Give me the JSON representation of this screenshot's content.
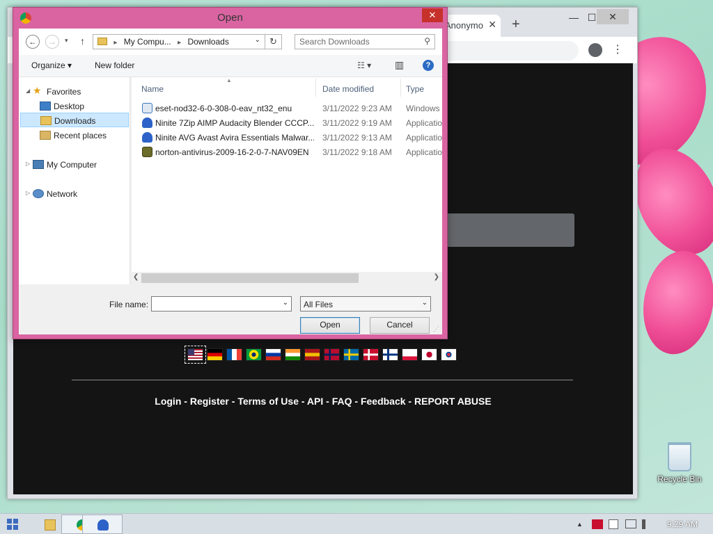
{
  "desktop": {
    "recycle_bin_label": "Recycle Bin"
  },
  "browser": {
    "tab_title": "Anonymo",
    "tab_close": "✕",
    "new_tab": "+",
    "minimize": "—",
    "maximize": "☐",
    "close": "✕",
    "menu": "⋮",
    "languages": [
      {
        "code": "en",
        "colors": [
          "#b22234",
          "#ffffff",
          "#3c3b6e"
        ],
        "selected": true
      },
      {
        "code": "de",
        "colors": [
          "#000000",
          "#dd0000",
          "#ffce00"
        ]
      },
      {
        "code": "fr",
        "colors": [
          "#0055a4",
          "#ffffff",
          "#ef4135"
        ]
      },
      {
        "code": "br",
        "colors": [
          "#009c3b",
          "#ffdf00",
          "#002776"
        ]
      },
      {
        "code": "ru",
        "colors": [
          "#ffffff",
          "#0039a6",
          "#d52b1e"
        ]
      },
      {
        "code": "in",
        "colors": [
          "#ff9933",
          "#ffffff",
          "#138808"
        ]
      },
      {
        "code": "es",
        "colors": [
          "#aa151b",
          "#f1bf00",
          "#aa151b"
        ]
      },
      {
        "code": "no",
        "colors": [
          "#ba0c2f",
          "#ffffff",
          "#00205b"
        ]
      },
      {
        "code": "se",
        "colors": [
          "#006aa7",
          "#fecc00",
          "#006aa7"
        ]
      },
      {
        "code": "dk",
        "colors": [
          "#c8102e",
          "#ffffff",
          "#c8102e"
        ]
      },
      {
        "code": "fi",
        "colors": [
          "#ffffff",
          "#003580",
          "#ffffff"
        ]
      },
      {
        "code": "pl",
        "colors": [
          "#ffffff",
          "#ffffff",
          "#dc143c"
        ]
      },
      {
        "code": "jp",
        "colors": [
          "#ffffff",
          "#bc002d",
          "#ffffff"
        ]
      },
      {
        "code": "kr",
        "colors": [
          "#ffffff",
          "#cd2e3a",
          "#0047a0"
        ]
      }
    ],
    "footer_links": [
      "Login",
      "Register",
      "Terms of Use",
      "API",
      "FAQ",
      "Feedback",
      "REPORT ABUSE"
    ],
    "footer_sep": " - "
  },
  "dialog": {
    "title": "Open",
    "close": "✕",
    "back": "←",
    "forward": "→",
    "recent_dropdown": "▾",
    "up": "↑",
    "breadcrumb": [
      "My Compu...",
      "Downloads"
    ],
    "breadcrumb_sep": "▸",
    "refresh": "↻",
    "search_placeholder": "Search Downloads",
    "search_icon": "⚲",
    "organize": "Organize ▾",
    "new_folder": "New folder",
    "view_icon": "☷ ▾",
    "preview_icon": "▥",
    "help": "?",
    "tree": [
      {
        "label": "Favorites",
        "icon": "star-icon",
        "expander": "◢"
      },
      {
        "label": "Desktop",
        "icon": "desktop-icon"
      },
      {
        "label": "Downloads",
        "icon": "downloads-folder-icon",
        "selected": true
      },
      {
        "label": "Recent places",
        "icon": "recent-places-icon"
      },
      {
        "label": "My Computer",
        "icon": "computer-icon",
        "expander": "▷"
      },
      {
        "label": "Network",
        "icon": "network-icon",
        "expander": "▷"
      }
    ],
    "columns": {
      "name": "Name",
      "date": "Date modified",
      "type": "Type"
    },
    "sort_indicator": "▲",
    "files": [
      {
        "name": "eset-nod32-6-0-308-0-eav_nt32_enu",
        "date": "3/11/2022 9:23 AM",
        "type": "Windows",
        "icon": "installer-icon",
        "color": "#3b77b8"
      },
      {
        "name": "Ninite 7Zip AIMP Audacity Blender CCCP...",
        "date": "3/11/2022 9:19 AM",
        "type": "Applicatio",
        "icon": "ninite-icon",
        "color": "#2d63c8"
      },
      {
        "name": "Ninite AVG Avast Avira Essentials Malwar...",
        "date": "3/11/2022 9:13 AM",
        "type": "Applicatio",
        "icon": "ninite-icon",
        "color": "#2d63c8"
      },
      {
        "name": "norton-antivirus-2009-16-2-0-7-NAV09EN",
        "date": "3/11/2022 9:18 AM",
        "type": "Applicatio",
        "icon": "norton-icon",
        "color": "#6b6b2a"
      }
    ],
    "scroll_left": "❮",
    "scroll_right": "❯",
    "file_name_label": "File name:",
    "file_name_value": "",
    "dropdown_arrow": "⌄",
    "file_type": "All Files",
    "open_button": "Open",
    "cancel_button": "Cancel",
    "grip": "⋰"
  },
  "taskbar": {
    "clock": "9:29 AM",
    "tray_up": "▲",
    "tray_icons": [
      "shield-icon",
      "flag-icon",
      "network-icon",
      "volume-icon"
    ]
  }
}
